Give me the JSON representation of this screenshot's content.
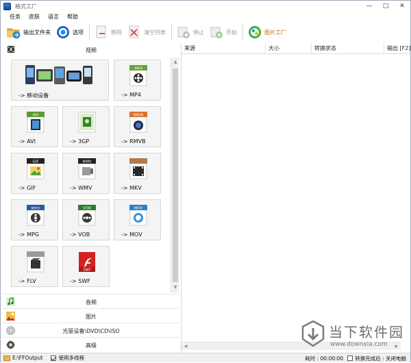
{
  "window": {
    "title": "格式工厂"
  },
  "menu": {
    "items": [
      "任务",
      "皮肤",
      "语言",
      "帮助"
    ]
  },
  "toolbar": {
    "output_folder": "输出文件夹",
    "options": "选项",
    "remove": "移除",
    "clear_list": "清空列表",
    "stop": "停止",
    "start": "开始",
    "picture_factory": "图片工厂"
  },
  "left": {
    "video_header": "视频",
    "tiles": [
      {
        "label": "-> 移动设备",
        "icon": "mobile-devices-icon"
      },
      {
        "label": "-> MP4",
        "icon": "mp4-icon",
        "badge": "MP4"
      },
      {
        "label": "-> AVI",
        "icon": "avi-icon",
        "badge": "AVI"
      },
      {
        "label": "-> 3GP",
        "icon": "3gp-icon",
        "badge": ""
      },
      {
        "label": "-> RMVB",
        "icon": "rmvb-icon",
        "badge": "RMVB"
      },
      {
        "label": "-> GIF",
        "icon": "gif-icon",
        "badge": "GIF"
      },
      {
        "label": "-> WMV",
        "icon": "wmv-icon",
        "badge": "WMV"
      },
      {
        "label": "-> MKV",
        "icon": "mkv-icon",
        "badge": ""
      },
      {
        "label": "-> MPG",
        "icon": "mpg-icon",
        "badge": "MPEG"
      },
      {
        "label": "-> VOB",
        "icon": "vob-icon",
        "badge": "VOB"
      },
      {
        "label": "-> MOV",
        "icon": "mov-icon",
        "badge": "MOV"
      },
      {
        "label": "-> FLV",
        "icon": "flv-icon",
        "badge": ""
      },
      {
        "label": "-> SWF",
        "icon": "swf-icon",
        "badge": "SWF"
      }
    ],
    "categories": [
      "音频",
      "图片",
      "光驱设备\\DVD\\CD\\ISO",
      "高级"
    ]
  },
  "right": {
    "columns": [
      "来源",
      "大小",
      "转换状态",
      "输出 [F2]"
    ]
  },
  "status": {
    "output_path": "E:\\FFOutput",
    "multithread": "使用多线程",
    "elapsed_label": "耗时 : 00:00:00",
    "after_label": "转换完成后 : 关闭电脑"
  },
  "watermark": {
    "text": "当下软件园",
    "url": "www.downxia.com"
  },
  "colors": {
    "accent": "#2f7fd2",
    "tile_bg": "#f4f4f4",
    "statusbar": "#f0f0f0"
  }
}
